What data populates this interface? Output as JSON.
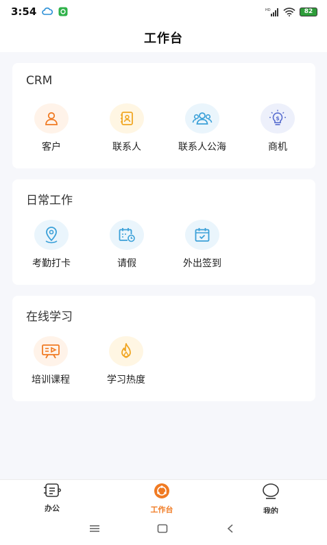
{
  "status": {
    "time": "3:54",
    "battery": "82",
    "network": "HD"
  },
  "header": {
    "title": "工作台"
  },
  "sections": [
    {
      "title": "CRM",
      "items": [
        {
          "label": "客户",
          "icon": "user-icon"
        },
        {
          "label": "联系人",
          "icon": "contact-card-icon"
        },
        {
          "label": "联系人公海",
          "icon": "group-icon"
        },
        {
          "label": "商机",
          "icon": "lightbulb-dollar-icon"
        }
      ]
    },
    {
      "title": "日常工作",
      "items": [
        {
          "label": "考勤打卡",
          "icon": "location-pin-icon"
        },
        {
          "label": "请假",
          "icon": "calendar-clock-icon"
        },
        {
          "label": "外出签到",
          "icon": "calendar-check-icon"
        }
      ]
    },
    {
      "title": "在线学习",
      "items": [
        {
          "label": "培训课程",
          "icon": "presentation-icon"
        },
        {
          "label": "学习热度",
          "icon": "flame-icon"
        }
      ]
    }
  ],
  "tabs": [
    {
      "label": "办公",
      "icon": "office-list-icon",
      "active": false
    },
    {
      "label": "工作台",
      "icon": "workbench-icon",
      "active": true
    },
    {
      "label": "我的",
      "icon": "profile-icon",
      "active": false
    }
  ],
  "colors": {
    "accent": "#f07a22",
    "blue": "#3aa0d8",
    "indigo": "#5a6fd0"
  }
}
